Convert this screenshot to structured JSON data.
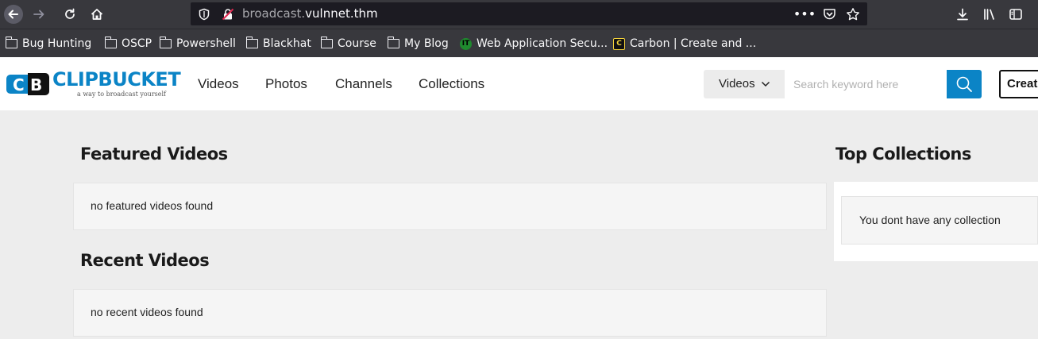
{
  "browser": {
    "url_subdomain": "broadcast.",
    "url_domain": "vulnnet.thm",
    "bookmarks": [
      "Bug Hunting",
      "OSCP",
      "Powershell",
      "Blackhat",
      "Course",
      "My Blog",
      "Web Application Secu...",
      "Carbon | Create and ..."
    ]
  },
  "site": {
    "logo_text": "CLIPBUCKET",
    "logo_badge": "CB",
    "tagline": "a way to broadcast yourself",
    "nav": [
      "Videos",
      "Photos",
      "Channels",
      "Collections"
    ],
    "search": {
      "type_label": "Videos",
      "placeholder": "Search keyword here"
    },
    "create_label": "Create"
  },
  "main": {
    "featured": {
      "title": "Featured Videos",
      "empty_text": "no featured videos found"
    },
    "recent": {
      "title": "Recent Videos",
      "empty_text": "no recent videos found"
    }
  },
  "sidebar": {
    "title": "Top Collections",
    "empty_text": "You dont have any collection"
  },
  "colors": {
    "brand": "#0b84c6",
    "chrome": "#38383d",
    "page_bg": "#ededed"
  }
}
